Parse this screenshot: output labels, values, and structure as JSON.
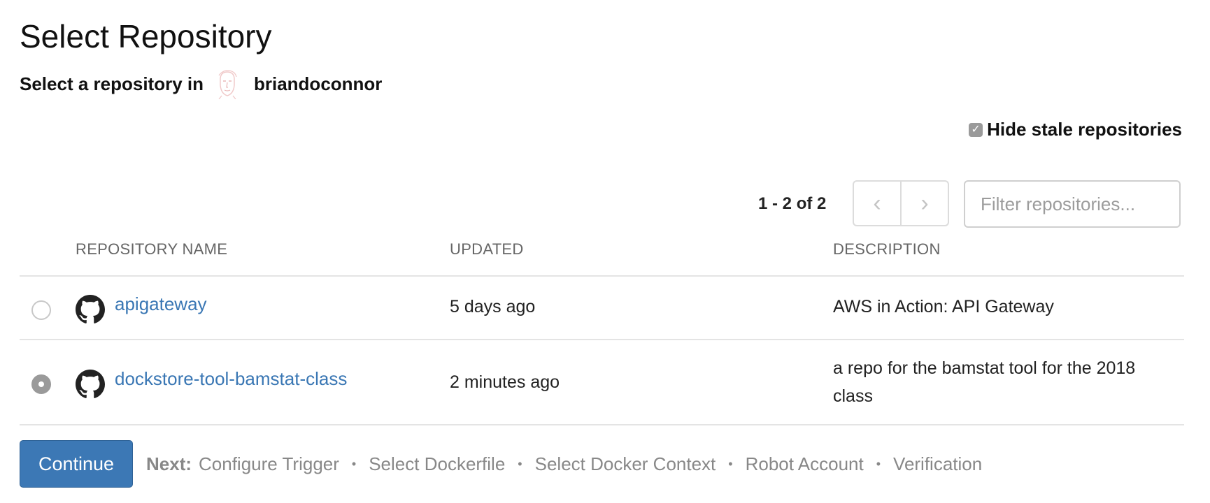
{
  "page": {
    "title": "Select Repository"
  },
  "namespace": {
    "prefix": "Select a repository in",
    "name": "briandoconnor",
    "avatar_icon": "user-sketch-avatar"
  },
  "options": {
    "hide_stale_label": "Hide stale repositories",
    "hide_stale_checked": true
  },
  "pagination": {
    "range": "1 - 2 of 2",
    "prev_glyph": "‹",
    "next_glyph": "›"
  },
  "filter": {
    "placeholder": "Filter repositories...",
    "value": ""
  },
  "table": {
    "columns": [
      "REPOSITORY NAME",
      "UPDATED",
      "DESCRIPTION"
    ],
    "rows": [
      {
        "selected": false,
        "icon": "github-icon",
        "name": "apigateway",
        "updated": "5 days ago",
        "description": "AWS in Action: API Gateway"
      },
      {
        "selected": true,
        "icon": "github-icon",
        "name": "dockstore-tool-bamstat-class",
        "updated": "2 minutes ago",
        "description": "a repo for the bamstat tool for the 2018 class"
      }
    ]
  },
  "footer": {
    "continue_label": "Continue",
    "next_label": "Next:",
    "steps": [
      "Configure Trigger",
      "Select Dockerfile",
      "Select Docker Context",
      "Robot Account",
      "Verification"
    ]
  },
  "colors": {
    "link": "#3a77b4",
    "primary_button": "#3c78b5",
    "muted_text": "#888888"
  }
}
